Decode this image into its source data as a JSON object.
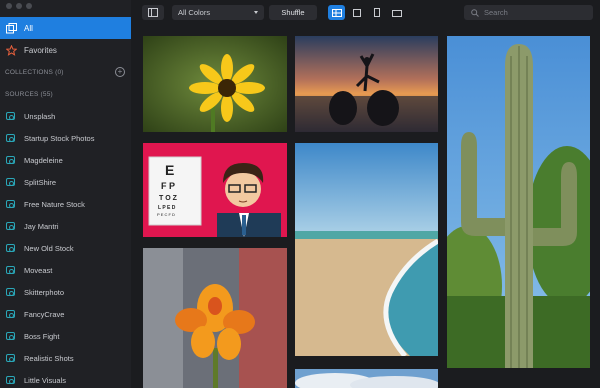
{
  "sidebar": {
    "top_items": [
      {
        "label": "All",
        "active": true
      },
      {
        "label": "Favorites",
        "active": false
      }
    ],
    "collections_title": "COLLECTIONS (0)",
    "sources_title": "SOURCES (55)",
    "sources": [
      "Unsplash",
      "Startup Stock Photos",
      "Magdeleine",
      "SplitShire",
      "Free Nature Stock",
      "Jay Mantri",
      "New Old Stock",
      "Moveast",
      "Skitterphoto",
      "FancyCrave",
      "Boss Fight",
      "Realistic Shots",
      "Little Visuals"
    ]
  },
  "toolbar": {
    "color_filter": "All Colors",
    "shuffle_label": "Shuffle",
    "search_placeholder": "Search"
  },
  "gallery": {
    "tiles": [
      {
        "subject": "yellow-flower"
      },
      {
        "subject": "yoga-sunset"
      },
      {
        "subject": "saguaro-cactus"
      },
      {
        "subject": "eye-chart-doctor"
      },
      {
        "subject": "beach-shore"
      },
      {
        "subject": "orange-flower"
      },
      {
        "subject": "clouds"
      }
    ]
  },
  "colors": {
    "accent": "#1f7fe0",
    "sidebar_bg": "#202125",
    "app_bg": "#1b1c1f",
    "source_icon": "#2aa7b8",
    "favorites_icon": "#e8603c"
  }
}
